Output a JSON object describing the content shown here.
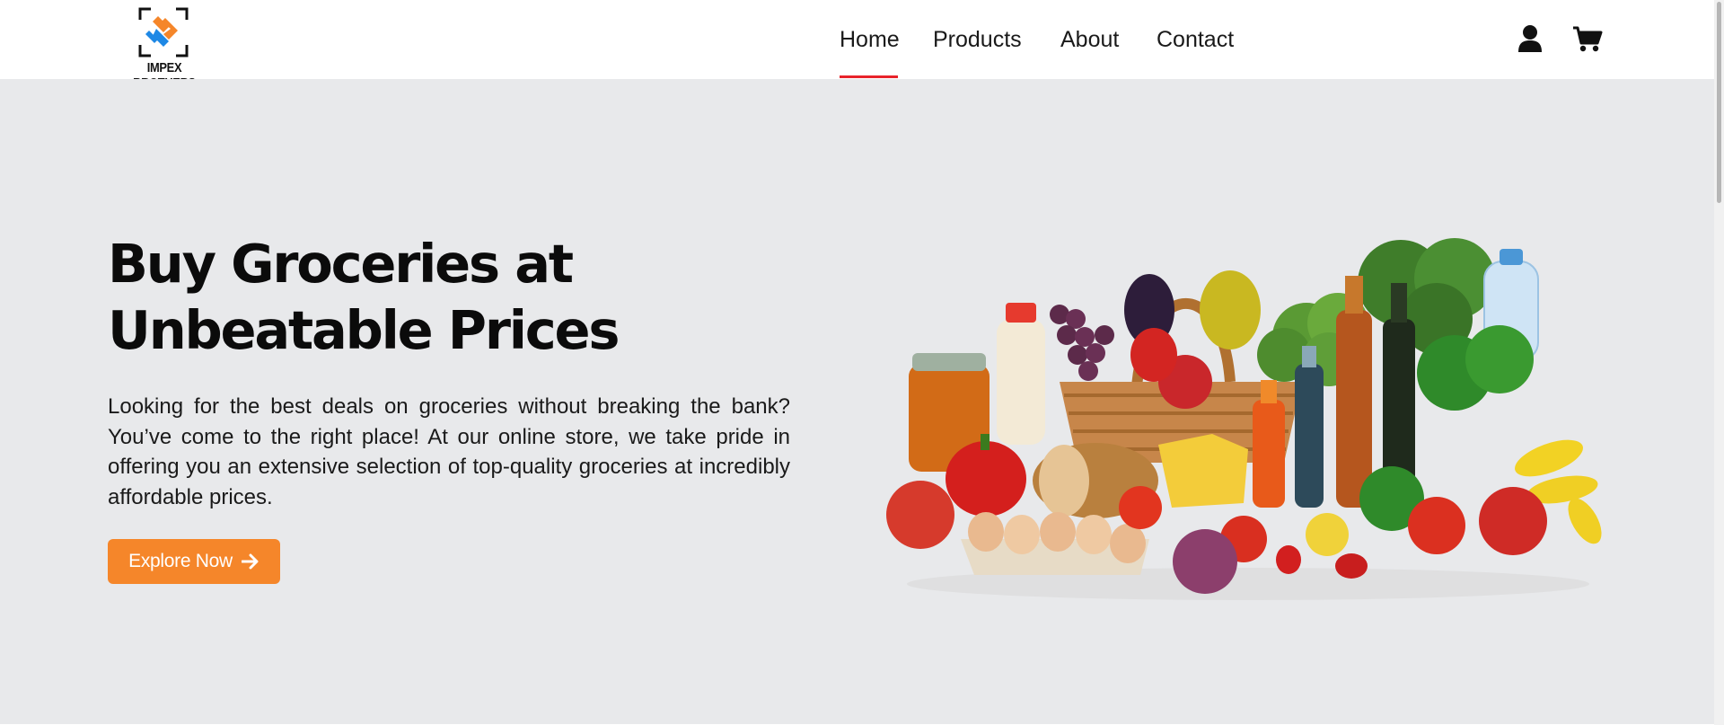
{
  "brand": {
    "name": "IMPEX BROTHERS",
    "colors": {
      "logo_orange": "#f5862a",
      "logo_blue": "#1e88e5",
      "logo_frame": "#111111"
    }
  },
  "nav": {
    "items": [
      {
        "label": "Home",
        "active": true
      },
      {
        "label": "Products",
        "active": false
      },
      {
        "label": "About",
        "active": false
      },
      {
        "label": "Contact",
        "active": false
      }
    ],
    "active_color": "#e8232a"
  },
  "header_icons": [
    {
      "name": "user-icon"
    },
    {
      "name": "shopping-cart-icon"
    }
  ],
  "hero": {
    "title": "Buy Groceries at Unbeatable Prices",
    "description": "Looking for the best deals on groceries without breaking the bank? You’ve come to the right place! At our online store, we take pride in offering you an extensive selection of top-quality groceries at incredibly affordable prices.",
    "cta": {
      "label": "Explore Now",
      "icon": "arrow-right-icon",
      "color": "#f5862a"
    },
    "background": "#e8e9eb",
    "image": {
      "icon": "grocery-basket-illustration"
    }
  }
}
